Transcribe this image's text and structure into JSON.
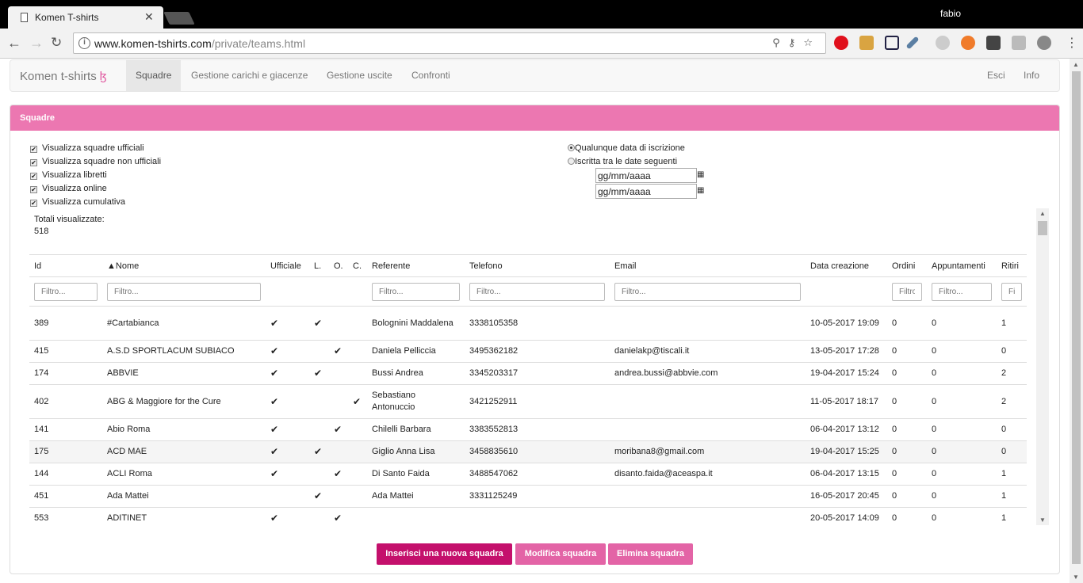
{
  "browser": {
    "tab_title": "Komen T-shirts",
    "user": "fabio",
    "url_host": "www.komen-tshirts.com",
    "url_path": "/private/teams.html"
  },
  "nav": {
    "brand": "Komen t-shirts",
    "items": [
      "Squadre",
      "Gestione carichi e giacenze",
      "Gestione uscite",
      "Confronti"
    ],
    "right": [
      "Esci",
      "Info"
    ]
  },
  "panel": {
    "title": "Squadre",
    "checkboxes": [
      "Visualizza squadre ufficiali",
      "Visualizza squadre non ufficiali",
      "Visualizza libretti",
      "Visualizza online",
      "Visualizza cumulativa"
    ],
    "radios": [
      "Qualunque data di iscrizione",
      "Iscritta tra le date seguenti"
    ],
    "date_value": "gg/mm/aaaa",
    "totals_label": "Totali visualizzate:",
    "totals_value": "518"
  },
  "table": {
    "headers": [
      "Id",
      "▲Nome",
      "Ufficiale",
      "L.",
      "O.",
      "C.",
      "Referente",
      "Telefono",
      "Email",
      "Data creazione",
      "Ordini",
      "Appuntamenti",
      "Ritiri"
    ],
    "filter_placeholders": {
      "id": "Filtro...",
      "nome": "Filtro...",
      "referente": "Filtro...",
      "telefono": "Filtro...",
      "email": "Filtro...",
      "ordini": "Filtro...",
      "appuntamenti": "Filtro...",
      "ritiri": "Filtro..."
    },
    "check": "✔",
    "rows": [
      {
        "id": "389",
        "nome": "#Cartabianca",
        "uff": "✔",
        "l": "✔",
        "o": "",
        "c": "",
        "ref": "Bolognini Maddalena",
        "tel": "3338105358",
        "email": "",
        "data": "10-05-2017 19:09",
        "ordini": "0",
        "app": "0",
        "ritiri": "1"
      },
      {
        "id": "415",
        "nome": "A.S.D SPORTLACUM SUBIACO",
        "uff": "✔",
        "l": "",
        "o": "✔",
        "c": "",
        "ref": "Daniela Pelliccia",
        "tel": "3495362182",
        "email": "danielakp@tiscali.it",
        "data": "13-05-2017 17:28",
        "ordini": "0",
        "app": "0",
        "ritiri": "0"
      },
      {
        "id": "174",
        "nome": "ABBVIE",
        "uff": "✔",
        "l": "✔",
        "o": "",
        "c": "",
        "ref": "Bussi Andrea",
        "tel": "3345203317",
        "email": "andrea.bussi@abbvie.com",
        "data": "19-04-2017 15:24",
        "ordini": "0",
        "app": "0",
        "ritiri": "2"
      },
      {
        "id": "402",
        "nome": "ABG & Maggiore for the Cure",
        "uff": "✔",
        "l": "",
        "o": "",
        "c": "✔",
        "ref": "Sebastiano Antonuccio",
        "tel": "3421252911",
        "email": "",
        "data": "11-05-2017 18:17",
        "ordini": "0",
        "app": "0",
        "ritiri": "2"
      },
      {
        "id": "141",
        "nome": "Abio Roma",
        "uff": "✔",
        "l": "",
        "o": "✔",
        "c": "",
        "ref": "Chilelli Barbara",
        "tel": "3383552813",
        "email": "",
        "data": "06-04-2017 13:12",
        "ordini": "0",
        "app": "0",
        "ritiri": "0"
      },
      {
        "id": "175",
        "nome": "ACD MAE",
        "uff": "✔",
        "l": "✔",
        "o": "",
        "c": "",
        "ref": "Giglio Anna Lisa",
        "tel": "3458835610",
        "email": "moribana8@gmail.com",
        "data": "19-04-2017 15:25",
        "ordini": "0",
        "app": "0",
        "ritiri": "0"
      },
      {
        "id": "144",
        "nome": "ACLI Roma",
        "uff": "✔",
        "l": "",
        "o": "✔",
        "c": "",
        "ref": "Di Santo Faida",
        "tel": "3488547062",
        "email": "disanto.faida@aceaspa.it",
        "data": "06-04-2017 13:15",
        "ordini": "0",
        "app": "0",
        "ritiri": "1"
      },
      {
        "id": "451",
        "nome": "Ada Mattei",
        "uff": "",
        "l": "✔",
        "o": "",
        "c": "",
        "ref": "Ada Mattei",
        "tel": "3331125249",
        "email": "",
        "data": "16-05-2017 20:45",
        "ordini": "0",
        "app": "0",
        "ritiri": "1"
      },
      {
        "id": "553",
        "nome": "ADITINET",
        "uff": "✔",
        "l": "",
        "o": "✔",
        "c": "",
        "ref": "",
        "tel": "",
        "email": "",
        "data": "20-05-2017 14:09",
        "ordini": "0",
        "app": "0",
        "ritiri": "1"
      }
    ]
  },
  "buttons": {
    "insert": "Inserisci una nuova squadra",
    "edit": "Modifica squadra",
    "delete": "Elimina squadra"
  }
}
